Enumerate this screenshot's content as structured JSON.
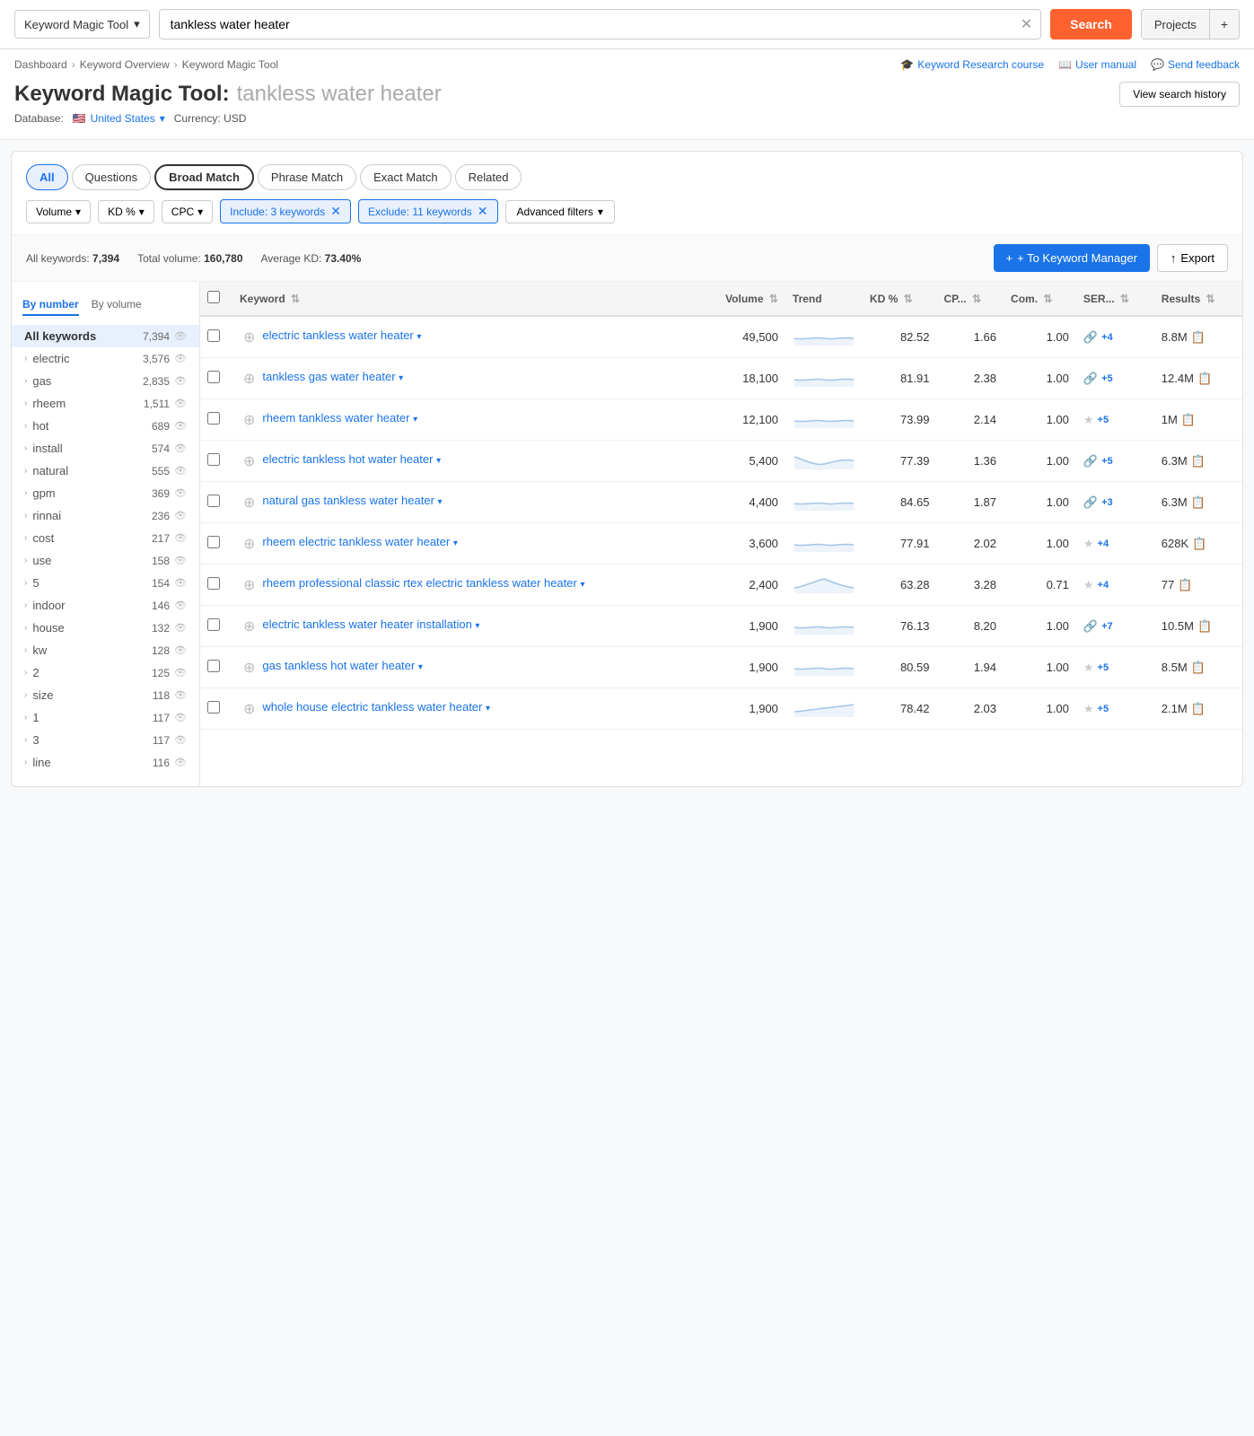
{
  "topbar": {
    "tool_label": "Keyword Magic Tool",
    "search_value": "tankless water heater",
    "search_btn": "Search",
    "projects_label": "Projects",
    "projects_plus": "+"
  },
  "breadcrumb": {
    "items": [
      "Dashboard",
      "Keyword Overview",
      "Keyword Magic Tool"
    ]
  },
  "top_links": [
    {
      "label": "Keyword Research course",
      "icon": "graduation-icon"
    },
    {
      "label": "User manual",
      "icon": "book-icon"
    },
    {
      "label": "Send feedback",
      "icon": "chat-icon"
    }
  ],
  "page_header": {
    "title_static": "Keyword Magic Tool:",
    "title_query": "tankless water heater",
    "view_history_btn": "View search history",
    "db_label": "Database:",
    "db_country": "United States",
    "currency_label": "Currency: USD"
  },
  "match_tabs": [
    {
      "label": "All",
      "active": true
    },
    {
      "label": "Questions",
      "active": false
    },
    {
      "label": "Broad Match",
      "active": false
    },
    {
      "label": "Phrase Match",
      "active": false
    },
    {
      "label": "Exact Match",
      "active": false
    },
    {
      "label": "Related",
      "active": false
    }
  ],
  "filter_dropdowns": [
    {
      "label": "Volume",
      "has_arrow": true
    },
    {
      "label": "KD %",
      "has_arrow": true
    },
    {
      "label": "CPC",
      "has_arrow": true
    }
  ],
  "filter_pills": [
    {
      "label": "Include: 3 keywords"
    },
    {
      "label": "Exclude: 11 keywords"
    }
  ],
  "advanced_filters_btn": "Advanced filters",
  "stats": {
    "all_keywords_label": "All keywords:",
    "all_keywords_value": "7,394",
    "total_volume_label": "Total volume:",
    "total_volume_value": "160,780",
    "avg_kd_label": "Average KD:",
    "avg_kd_value": "73.40%"
  },
  "action_btns": {
    "kw_manager": "+ To Keyword Manager",
    "export": "Export"
  },
  "sidebar_nav": [
    "By number",
    "By volume"
  ],
  "sidebar_items": [
    {
      "label": "All keywords",
      "count": "7,394",
      "active": true
    },
    {
      "label": "electric",
      "count": "3,576"
    },
    {
      "label": "gas",
      "count": "2,835"
    },
    {
      "label": "rheem",
      "count": "1,511"
    },
    {
      "label": "hot",
      "count": "689"
    },
    {
      "label": "install",
      "count": "574"
    },
    {
      "label": "natural",
      "count": "555"
    },
    {
      "label": "gpm",
      "count": "369"
    },
    {
      "label": "rinnai",
      "count": "236"
    },
    {
      "label": "cost",
      "count": "217"
    },
    {
      "label": "use",
      "count": "158"
    },
    {
      "label": "5",
      "count": "154"
    },
    {
      "label": "indoor",
      "count": "146"
    },
    {
      "label": "house",
      "count": "132"
    },
    {
      "label": "kw",
      "count": "128"
    },
    {
      "label": "2",
      "count": "125"
    },
    {
      "label": "size",
      "count": "118"
    },
    {
      "label": "1",
      "count": "117"
    },
    {
      "label": "3",
      "count": "117"
    },
    {
      "label": "line",
      "count": "116"
    }
  ],
  "table_headers": [
    {
      "label": "Keyword",
      "sortable": true
    },
    {
      "label": "Volume",
      "sortable": true
    },
    {
      "label": "Trend",
      "sortable": false
    },
    {
      "label": "KD %",
      "sortable": true
    },
    {
      "label": "CP...",
      "sortable": true
    },
    {
      "label": "Com.",
      "sortable": true
    },
    {
      "label": "SER...",
      "sortable": true
    },
    {
      "label": "Results",
      "sortable": true
    }
  ],
  "table_rows": [
    {
      "keyword": "electric tankless water heater",
      "volume": "49,500",
      "kd": "82.52",
      "cpc": "1.66",
      "com": "1.00",
      "serp_icon": "link",
      "serp_plus": "+4",
      "results": "8.8M",
      "trend": "flat_low"
    },
    {
      "keyword": "tankless gas water heater",
      "volume": "18,100",
      "kd": "81.91",
      "cpc": "2.38",
      "com": "1.00",
      "serp_icon": "link",
      "serp_plus": "+5",
      "results": "12.4M",
      "trend": "flat_low"
    },
    {
      "keyword": "rheem tankless water heater",
      "volume": "12,100",
      "kd": "73.99",
      "cpc": "2.14",
      "com": "1.00",
      "serp_icon": "star",
      "serp_plus": "+5",
      "results": "1M",
      "trend": "flat_low"
    },
    {
      "keyword": "electric tankless hot water heater",
      "volume": "5,400",
      "kd": "77.39",
      "cpc": "1.36",
      "com": "1.00",
      "serp_icon": "link",
      "serp_plus": "+5",
      "results": "6.3M",
      "trend": "dip"
    },
    {
      "keyword": "natural gas tankless water heater",
      "volume": "4,400",
      "kd": "84.65",
      "cpc": "1.87",
      "com": "1.00",
      "serp_icon": "link",
      "serp_plus": "+3",
      "results": "6.3M",
      "trend": "flat_low"
    },
    {
      "keyword": "rheem electric tankless water heater",
      "volume": "3,600",
      "kd": "77.91",
      "cpc": "2.02",
      "com": "1.00",
      "serp_icon": "star",
      "serp_plus": "+4",
      "results": "628K",
      "trend": "flat_low"
    },
    {
      "keyword": "rheem professional classic rtex electric tankless water heater",
      "volume": "2,400",
      "kd": "63.28",
      "cpc": "3.28",
      "com": "0.71",
      "serp_icon": "star",
      "serp_plus": "+4",
      "results": "77",
      "trend": "peak"
    },
    {
      "keyword": "electric tankless water heater installation",
      "volume": "1,900",
      "kd": "76.13",
      "cpc": "8.20",
      "com": "1.00",
      "serp_icon": "link",
      "serp_plus": "+7",
      "results": "10.5M",
      "trend": "flat_low"
    },
    {
      "keyword": "gas tankless hot water heater",
      "volume": "1,900",
      "kd": "80.59",
      "cpc": "1.94",
      "com": "1.00",
      "serp_icon": "star",
      "serp_plus": "+5",
      "results": "8.5M",
      "trend": "flat_low"
    },
    {
      "keyword": "whole house electric tankless water heater",
      "volume": "1,900",
      "kd": "78.42",
      "cpc": "2.03",
      "com": "1.00",
      "serp_icon": "star",
      "serp_plus": "+5",
      "results": "2.1M",
      "trend": "slight_rise"
    }
  ]
}
